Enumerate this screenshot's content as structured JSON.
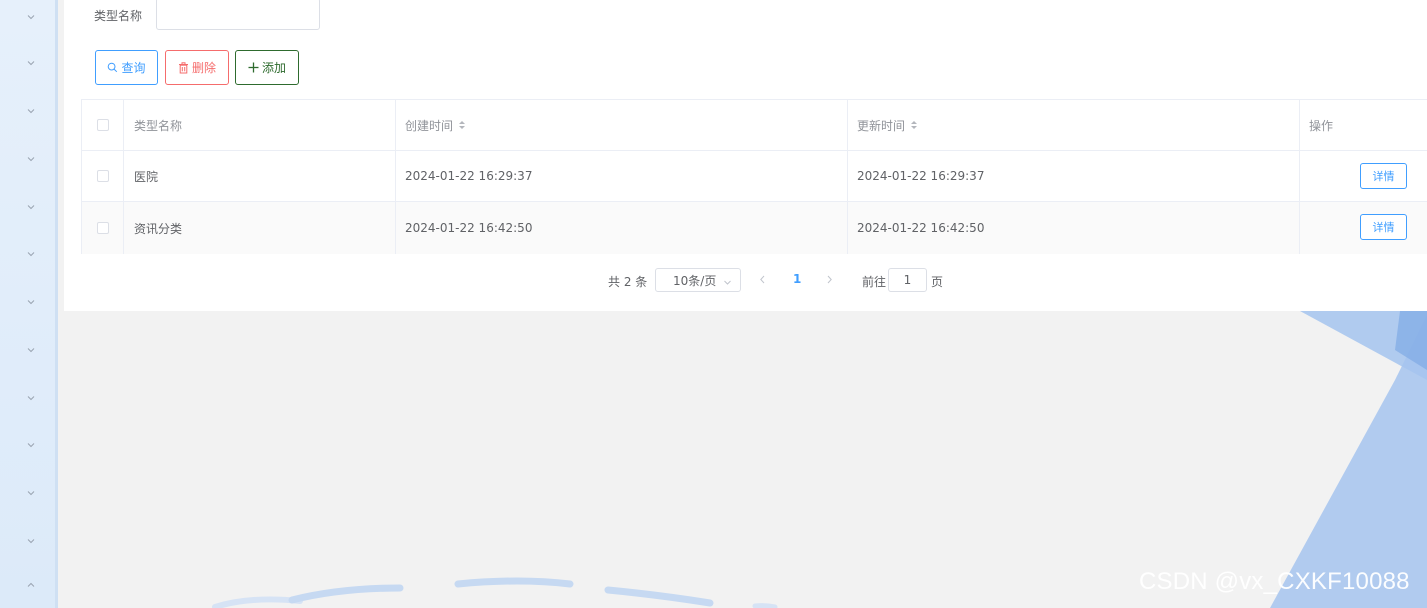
{
  "search": {
    "label": "类型名称",
    "value": "",
    "placeholder": ""
  },
  "toolbar": {
    "query_label": "查询",
    "delete_label": "删除",
    "add_label": "添加"
  },
  "table": {
    "headers": {
      "name": "类型名称",
      "created": "创建时间",
      "updated": "更新时间",
      "actions": "操作"
    },
    "rows": [
      {
        "name": "医院",
        "created": "2024-01-22 16:29:37",
        "updated": "2024-01-22 16:29:37",
        "action": "详情"
      },
      {
        "name": "资讯分类",
        "created": "2024-01-22 16:42:50",
        "updated": "2024-01-22 16:42:50",
        "action": "详情"
      }
    ]
  },
  "pagination": {
    "total": "共 2 条",
    "page_size": "10条/页",
    "current_page": "1",
    "goto_label": "前往",
    "goto_value": "1",
    "page_suffix": "页"
  },
  "watermark": "CSDN @vx_CXKF10088",
  "colors": {
    "primary": "#409eff",
    "danger": "#f56c6c",
    "success_dark": "#2e6b2e",
    "border": "#ebeef5",
    "sidebar": "#e6f0fb"
  },
  "icons": {
    "sidebar": "chevron-down-icon",
    "sidebar_last": "chevron-up-icon",
    "query": "search-icon",
    "delete": "trash-icon",
    "add": "plus-icon",
    "sort": "sort-icon"
  }
}
